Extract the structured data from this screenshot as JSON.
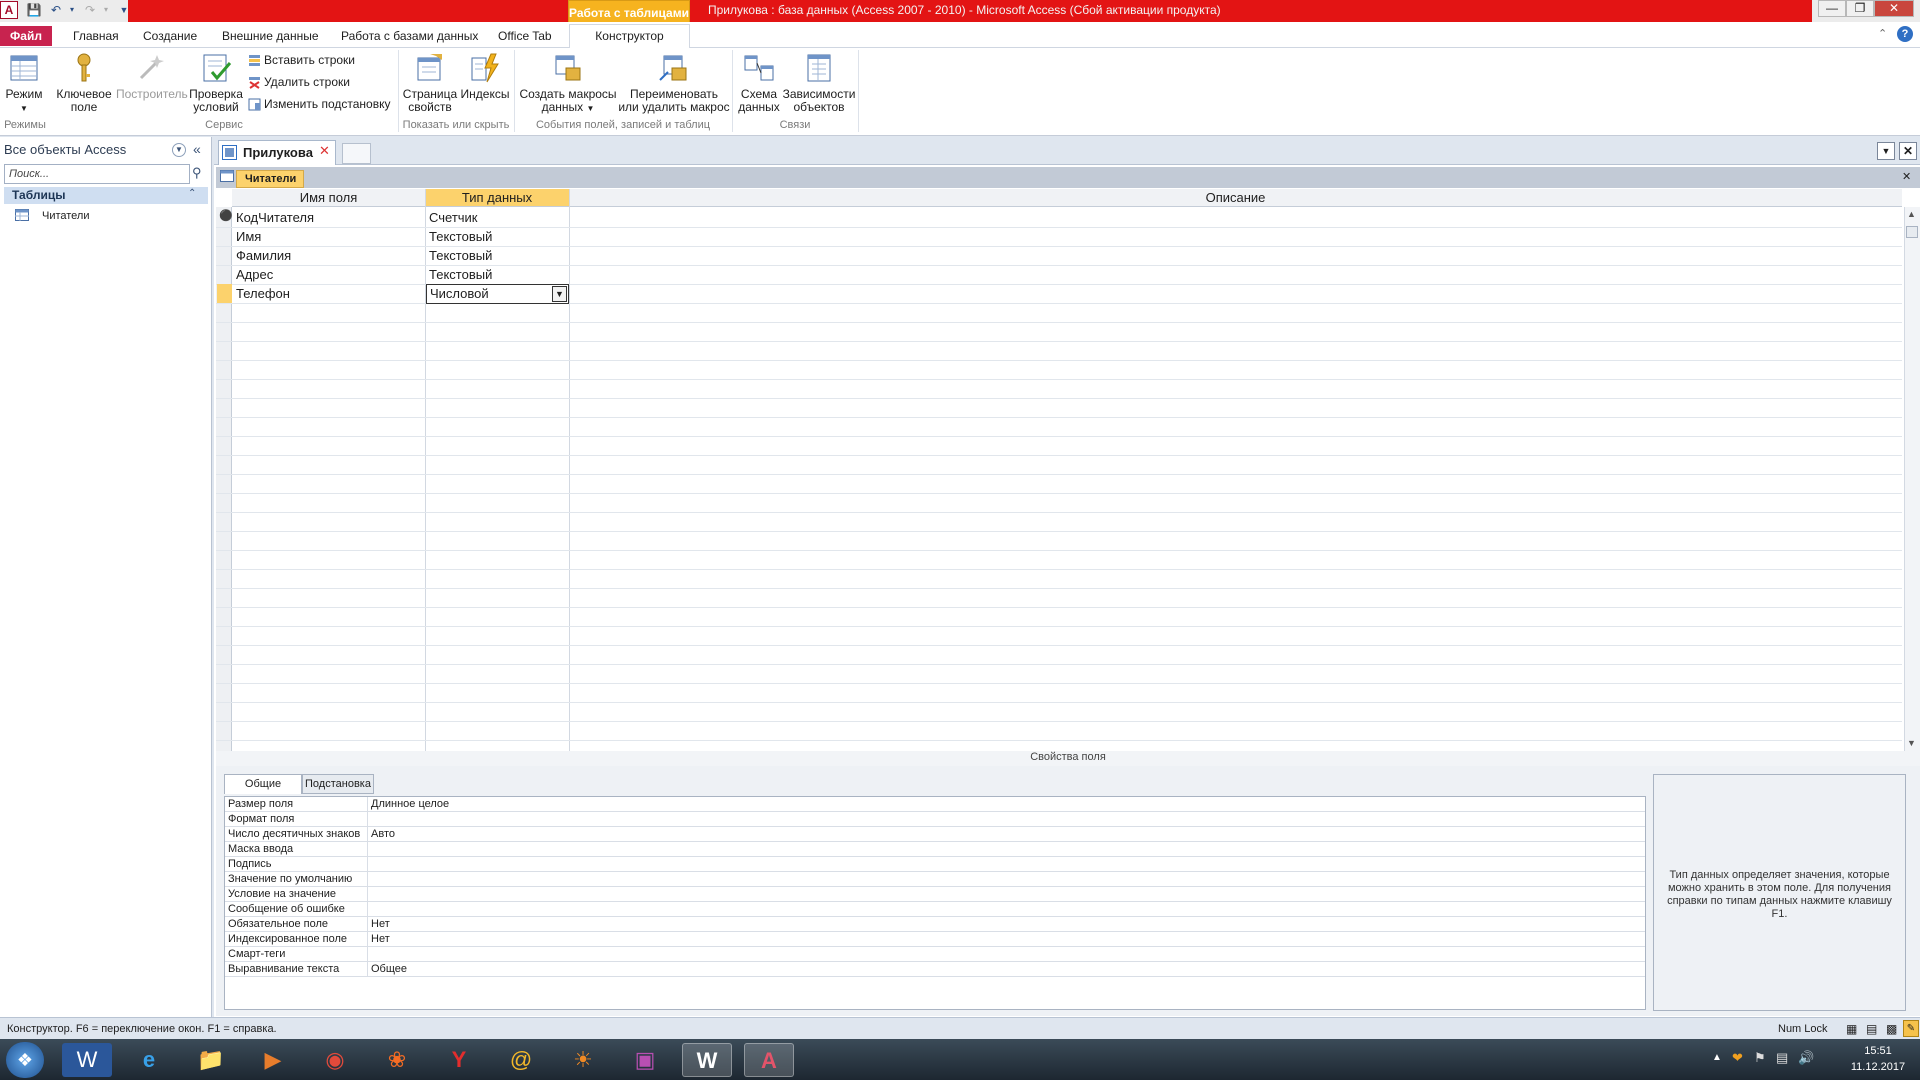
{
  "titlebar": {
    "app_icon": "A",
    "context_tab": "Работа с таблицами",
    "title": "Прилукова : база данных (Access 2007 - 2010)  -  Microsoft Access (Сбой активации продукта)"
  },
  "ribbon_tabs": {
    "file": "Файл",
    "home": "Главная",
    "create": "Создание",
    "external": "Внешние данные",
    "db_tools": "Работа с базами данных",
    "office_tab": "Office Tab",
    "designer": "Конструктор"
  },
  "ribbon": {
    "mode": "Режим",
    "key_field_1": "Ключевое",
    "key_field_2": "поле",
    "builder": "Построитель",
    "check_1": "Проверка",
    "check_2": "условий",
    "insert_rows": "Вставить строки",
    "delete_rows": "Удалить строки",
    "modify_lookup": "Изменить подстановку",
    "prop_sheet_1": "Страница",
    "prop_sheet_2": "свойств",
    "indexes": "Индексы",
    "create_macros_1": "Создать макросы",
    "create_macros_2": "данных",
    "rename_macro_1": "Переименовать",
    "rename_macro_2": "или удалить макрос",
    "schema_1": "Схема",
    "schema_2": "данных",
    "deps_1": "Зависимости",
    "deps_2": "объектов",
    "group_modes": "Режимы",
    "group_service": "Сервис",
    "group_show": "Показать или скрыть",
    "group_events": "События полей, записей и таблиц",
    "group_links": "Связи"
  },
  "nav": {
    "header": "Все объекты Access",
    "search_placeholder": "Поиск...",
    "category": "Таблицы",
    "item": "Читатели"
  },
  "doc": {
    "tab": "Прилукова",
    "object_tab": "Читатели"
  },
  "grid": {
    "headers": [
      "Имя поля",
      "Тип данных",
      "Описание"
    ],
    "rows": [
      {
        "name": "КодЧитателя",
        "type": "Счетчик",
        "key": true
      },
      {
        "name": "Имя",
        "type": "Текстовый"
      },
      {
        "name": "Фамилия",
        "type": "Текстовый"
      },
      {
        "name": "Адрес",
        "type": "Текстовый"
      },
      {
        "name": "Телефон",
        "type": "Числовой",
        "current": true
      }
    ]
  },
  "props": {
    "title": "Свойства поля",
    "tab_general": "Общие",
    "tab_lookup": "Подстановка",
    "rows": [
      {
        "label": "Размер поля",
        "value": "Длинное целое"
      },
      {
        "label": "Формат поля",
        "value": ""
      },
      {
        "label": "Число десятичных знаков",
        "value": "Авто"
      },
      {
        "label": "Маска ввода",
        "value": ""
      },
      {
        "label": "Подпись",
        "value": ""
      },
      {
        "label": "Значение по умолчанию",
        "value": ""
      },
      {
        "label": "Условие на значение",
        "value": ""
      },
      {
        "label": "Сообщение об ошибке",
        "value": ""
      },
      {
        "label": "Обязательное поле",
        "value": "Нет"
      },
      {
        "label": "Индексированное поле",
        "value": "Нет"
      },
      {
        "label": "Смарт-теги",
        "value": ""
      },
      {
        "label": "Выравнивание текста",
        "value": "Общее"
      }
    ],
    "help": "Тип данных определяет значения, которые можно хранить в этом поле. Для получения справки по типам данных нажмите клавишу F1."
  },
  "status": {
    "left": "Конструктор.  F6 = переключение окон.  F1 = справка.",
    "numlock": "Num Lock"
  },
  "taskbar": {
    "time": "15:51",
    "date": "11.12.2017"
  }
}
